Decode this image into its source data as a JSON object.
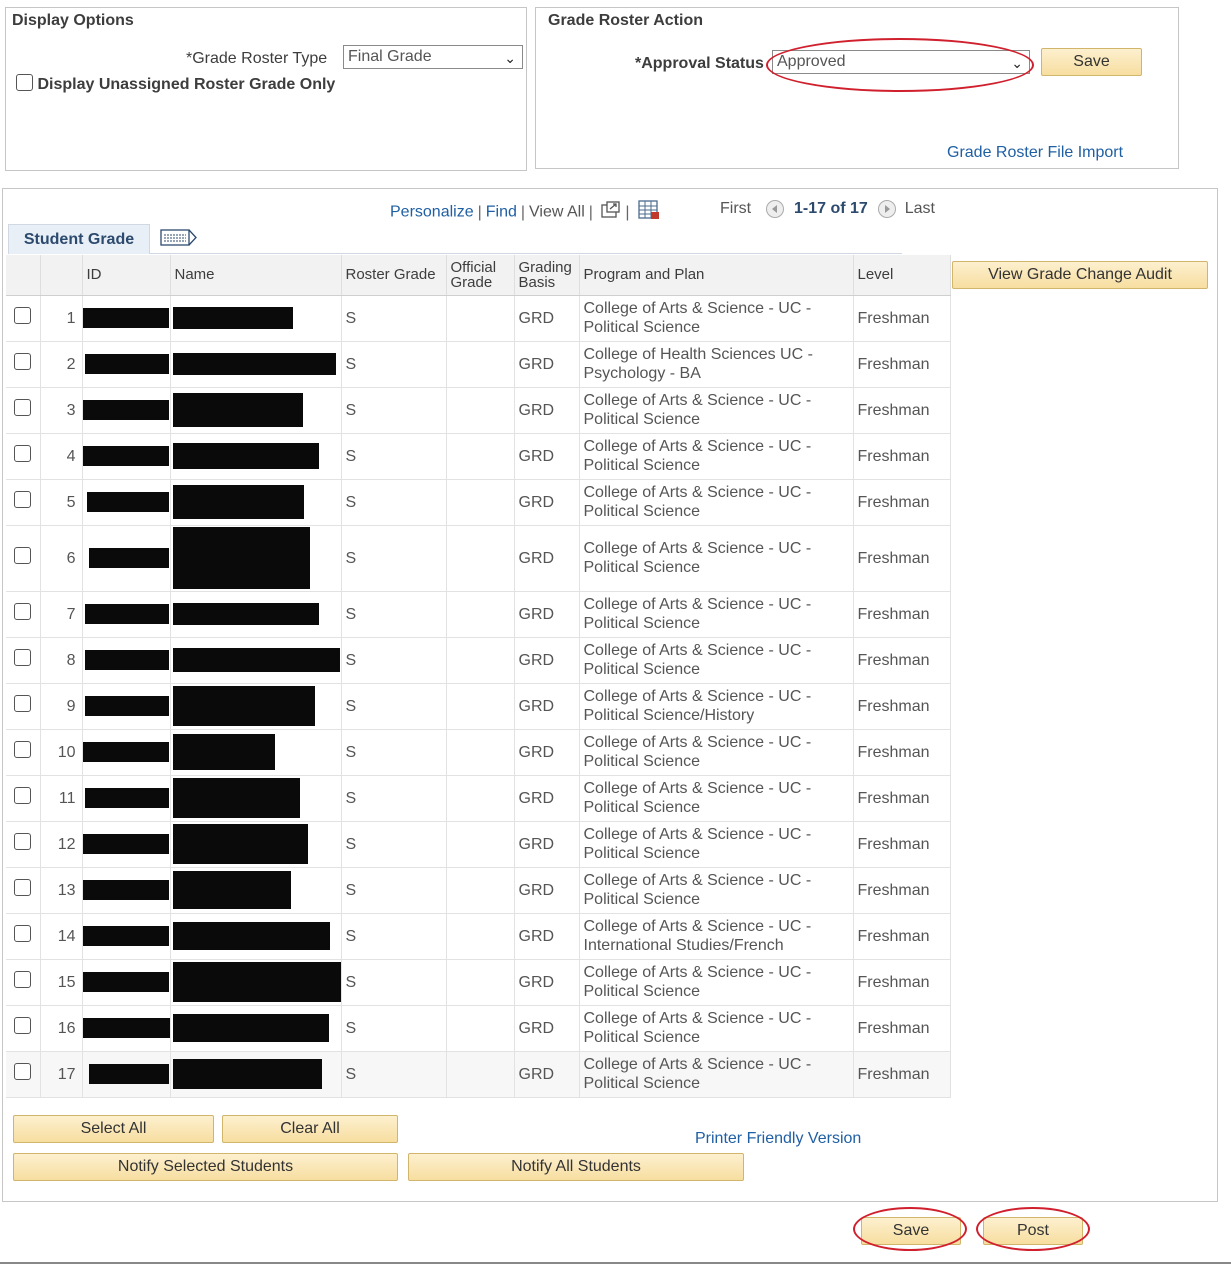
{
  "display_options": {
    "title": "Display Options",
    "roster_type_label": "*Grade Roster Type",
    "roster_type_value": "Final Grade",
    "unassigned_label": "Display Unassigned Roster Grade Only"
  },
  "grade_roster_action": {
    "title": "Grade Roster Action",
    "approval_status_label": "*Approval Status",
    "approval_status_value": "Approved",
    "save_label": "Save",
    "file_import_link": "Grade Roster File Import"
  },
  "grid_nav": {
    "personalize": "Personalize",
    "find": "Find",
    "view_all": "View All",
    "first": "First",
    "range": "1-17 of 17",
    "last": "Last",
    "sep": "|"
  },
  "tab": {
    "label": "Student Grade"
  },
  "columns": {
    "id": "ID",
    "name": "Name",
    "roster_grade": "Roster Grade",
    "official_grade_1": "Official",
    "official_grade_2": "Grade",
    "grading_basis_1": "Grading",
    "grading_basis_2": "Basis",
    "program_plan": "Program and Plan",
    "level": "Level"
  },
  "view_audit_label": "View Grade Change Audit",
  "rows": [
    {
      "num": "1",
      "grade": "S",
      "basis": "GRD",
      "program1": "College of Arts & Science - UC -",
      "program2": "Political Science",
      "level": "Freshman"
    },
    {
      "num": "2",
      "grade": "S",
      "basis": "GRD",
      "program1": "College of Health Sciences UC -",
      "program2": "Psychology - BA",
      "level": "Freshman"
    },
    {
      "num": "3",
      "grade": "S",
      "basis": "GRD",
      "program1": "College of Arts & Science - UC -",
      "program2": "Political Science",
      "level": "Freshman"
    },
    {
      "num": "4",
      "grade": "S",
      "basis": "GRD",
      "program1": "College of Arts & Science - UC -",
      "program2": "Political Science",
      "level": "Freshman"
    },
    {
      "num": "5",
      "grade": "S",
      "basis": "GRD",
      "program1": "College of Arts & Science - UC -",
      "program2": "Political Science",
      "level": "Freshman"
    },
    {
      "num": "6",
      "grade": "S",
      "basis": "GRD",
      "program1": "College of Arts & Science - UC -",
      "program2": "Political Science",
      "level": "Freshman"
    },
    {
      "num": "7",
      "grade": "S",
      "basis": "GRD",
      "program1": "College of Arts & Science - UC -",
      "program2": "Political Science",
      "level": "Freshman"
    },
    {
      "num": "8",
      "grade": "S",
      "basis": "GRD",
      "program1": "College of Arts & Science - UC -",
      "program2": "Political Science",
      "level": "Freshman"
    },
    {
      "num": "9",
      "grade": "S",
      "basis": "GRD",
      "program1": "College of Arts & Science - UC -",
      "program2": "Political Science/History",
      "level": "Freshman"
    },
    {
      "num": "10",
      "grade": "S",
      "basis": "GRD",
      "program1": "College of Arts & Science - UC -",
      "program2": "Political Science",
      "level": "Freshman"
    },
    {
      "num": "11",
      "grade": "S",
      "basis": "GRD",
      "program1": "College of Arts & Science - UC -",
      "program2": "Political Science",
      "level": "Freshman"
    },
    {
      "num": "12",
      "grade": "S",
      "basis": "GRD",
      "program1": "College of Arts & Science - UC -",
      "program2": "Political Science",
      "level": "Freshman"
    },
    {
      "num": "13",
      "grade": "S",
      "basis": "GRD",
      "program1": "College of Arts & Science - UC -",
      "program2": "Political Science",
      "level": "Freshman"
    },
    {
      "num": "14",
      "grade": "S",
      "basis": "GRD",
      "program1": "College of Arts & Science - UC -",
      "program2": "International Studies/French",
      "level": "Freshman"
    },
    {
      "num": "15",
      "grade": "S",
      "basis": "GRD",
      "program1": "College of Arts & Science - UC -",
      "program2": "Political Science",
      "level": "Freshman"
    },
    {
      "num": "16",
      "grade": "S",
      "basis": "GRD",
      "program1": "College of Arts & Science - UC -",
      "program2": "Political Science",
      "level": "Freshman"
    },
    {
      "num": "17",
      "grade": "S",
      "basis": "GRD",
      "program1": "College of Arts & Science - UC -",
      "program2": "Political Science",
      "level": "Freshman"
    }
  ],
  "bottom": {
    "select_all": "Select All",
    "clear_all": "Clear All",
    "notify_selected": "Notify Selected Students",
    "notify_all": "Notify All Students",
    "printer_friendly": "Printer Friendly Version",
    "save": "Save",
    "post": "Post"
  },
  "colors": {
    "accent_link": "#1f5fa3",
    "button_fill": "#f7dea0",
    "highlight_oval": "#d0202d"
  }
}
